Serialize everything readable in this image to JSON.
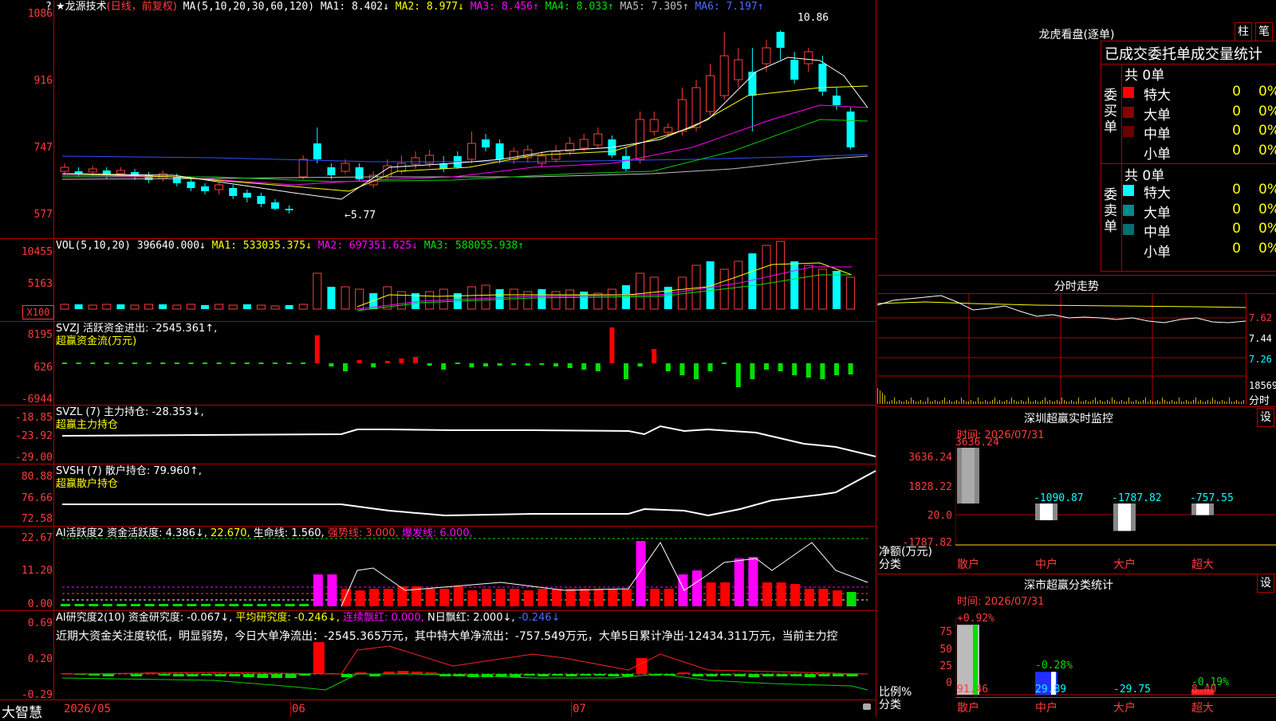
{
  "stock": {
    "star": "★",
    "name": "龙源技术",
    "period": "(日线，前复权)"
  },
  "main_legend": {
    "ma_params": "MA(5,10,20,30,60,120)",
    "ma1": "MA1: 8.402↓",
    "ma2": "MA2: 8.977↓",
    "ma3": "MA3: 8.456↑",
    "ma4": "MA4: 8.033↑",
    "ma5": "MA5: 7.305↑",
    "ma6": "MA6: 7.197↑"
  },
  "main_axis": [
    "1086",
    "916",
    "747",
    "577"
  ],
  "price_high": "10.86",
  "price_low": "←5.77",
  "vol_legend": {
    "params": "VOL(5,10,20)",
    "vol": "396640.000↓",
    "ma1": "MA1: 533035.375↓",
    "ma2": "MA2: 697351.625↓",
    "ma3": "MA3: 588055.938↑"
  },
  "vol_axis": [
    "10455",
    "5163"
  ],
  "vol_unit": "X100",
  "svzj": {
    "legend": "SVZJ  活跃资金进出: -2545.361↑,",
    "sub": "超赢资金流(万元)",
    "axis": [
      "8195",
      "626",
      "-6944"
    ]
  },
  "svzl": {
    "legend": "SVZL (7) 主力持仓: -28.353↓,",
    "sub": "超赢主力持仓",
    "axis": [
      "-18.85",
      "-23.92",
      "-29.00"
    ]
  },
  "svsh": {
    "legend": "SVSH (7) 散户持仓: 79.960↑,",
    "sub": "超赢散户持仓",
    "axis": [
      "80.88",
      "76.66",
      "72.58"
    ]
  },
  "ai_active": {
    "l1": "AI活跃度2 资金活跃度: 4.386↓,",
    "l2": "22.670,",
    "l3": "生命线: 1.560,",
    "l4": "强势线: 3.000,",
    "l5": "爆发线: 6.000,",
    "axis": [
      "22.67",
      "11.20",
      "0.00"
    ]
  },
  "ai_research": {
    "l1": "AI研究度2(10) 资金研究度: -0.067↓,",
    "l2": "平均研究度: -0.246↓,",
    "l3": "连续飘红: 0.000,",
    "l4": "N日飘红: 2.000↓,",
    "l5": "-0.246↓",
    "text": "近期大资金关注度较低，明显弱势，今日大单净流出：-2545.365万元，其中特大单净流出：-757.549万元，大单5日累计净出-12434.311万元，当前主力控",
    "axis": [
      "0.69",
      "0.20",
      "-0.29"
    ]
  },
  "bottom": {
    "brand": "大智慧",
    "d1": "2026/05",
    "d2": "06",
    "d3": "07"
  },
  "longhu": {
    "title": "龙虎看盘(逐单)",
    "btn1": "柱",
    "btn2": "笔",
    "tabs": "已成交委托单成交量统计",
    "buy": {
      "label": "委买单",
      "total": "共 0单",
      "rows": [
        {
          "name": "特大",
          "v": "0",
          "p": "0%",
          "color": "#ff0000"
        },
        {
          "name": "大单",
          "v": "0",
          "p": "0%",
          "color": "#8b0000"
        },
        {
          "name": "中单",
          "v": "0",
          "p": "0%",
          "color": "#6a0000"
        },
        {
          "name": "小单",
          "v": "0",
          "p": "0%",
          "color": "#000000"
        }
      ]
    },
    "sell": {
      "label": "委卖单",
      "total": "共 0单",
      "rows": [
        {
          "name": "特大",
          "v": "0",
          "p": "0%",
          "color": "#00ffff"
        },
        {
          "name": "大单",
          "v": "0",
          "p": "0%",
          "color": "#008b8b"
        },
        {
          "name": "中单",
          "v": "0",
          "p": "0%",
          "color": "#007070"
        },
        {
          "name": "小单",
          "v": "0",
          "p": "0%",
          "color": "#000000"
        }
      ]
    }
  },
  "intraday": {
    "title": "分时走势",
    "axis": [
      "7.62",
      "7.44",
      "7.26"
    ],
    "vol": "18569",
    "lbl": "分时"
  },
  "sz_monitor": {
    "title": "深圳超赢实时监控",
    "btn": "设",
    "time": "时间: 2026/07/31",
    "axis": [
      "3636.24",
      "1828.22",
      "20.0",
      "-1787.82"
    ],
    "ylab": "净额(万元)",
    "xlab": "分类",
    "cats": [
      "散户",
      "中户",
      "大户",
      "超大"
    ],
    "vals": [
      "3636.24",
      "-1090.87",
      "-1787.82",
      "-757.55"
    ]
  },
  "sz_class": {
    "title": "深市超赢分类统计",
    "btn": "设",
    "time": "时间: 2026/07/31",
    "axis": [
      "75",
      "50",
      "25",
      "0"
    ],
    "ylab": "比例%",
    "xlab": "分类",
    "cats": [
      "散户",
      "中户",
      "大户",
      "超大"
    ],
    "top": [
      "+0.92%",
      "-0.28%",
      "",
      "-0.19%"
    ],
    "vals": [
      "91.46",
      "29.89",
      "-29.75",
      "8.40"
    ]
  }
}
